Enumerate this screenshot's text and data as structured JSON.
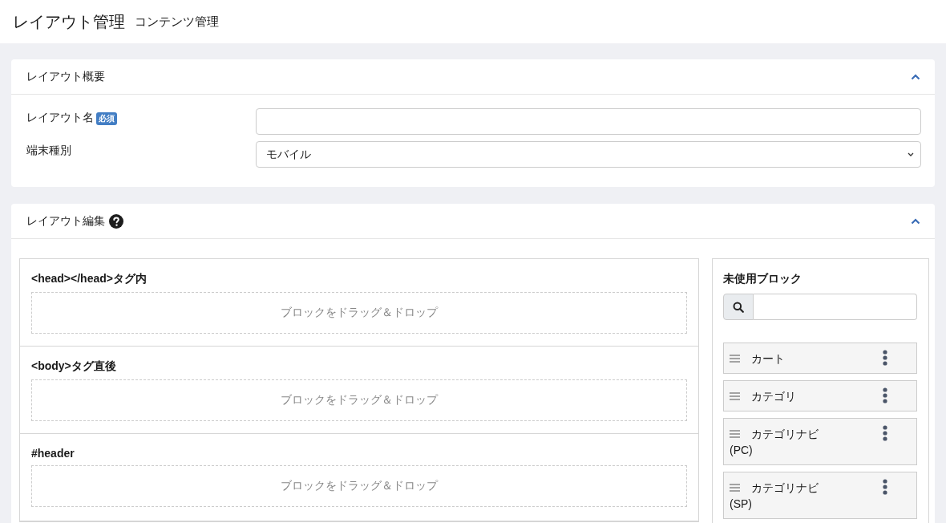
{
  "header": {
    "title": "レイアウト管理",
    "subtitle": "コンテンツ管理"
  },
  "overview": {
    "title": "レイアウト概要",
    "expanded": true,
    "fields": [
      {
        "kind": "text",
        "label": "レイアウト名",
        "badge": "必須"
      },
      {
        "kind": "select",
        "label": "端末種別",
        "value": "モバイル"
      }
    ]
  },
  "editor": {
    "title": "レイアウト編集",
    "expanded": true,
    "sections": [
      {
        "title": "<head></head>タグ内",
        "dropzone": "ブロックをドラッグ＆ドロップ"
      },
      {
        "title": "<body>タグ直後",
        "dropzone": "ブロックをドラッグ＆ドロップ"
      },
      {
        "title": "#header",
        "dropzone": "ブロックをドラッグ＆ドロップ"
      }
    ],
    "unused": {
      "title": "未使用ブロック",
      "blocks": [
        {
          "name": "カート"
        },
        {
          "name": "カテゴリ"
        },
        {
          "name": "カテゴリナビ (PC)"
        },
        {
          "name": "カテゴリナビ (SP)"
        }
      ]
    }
  }
}
